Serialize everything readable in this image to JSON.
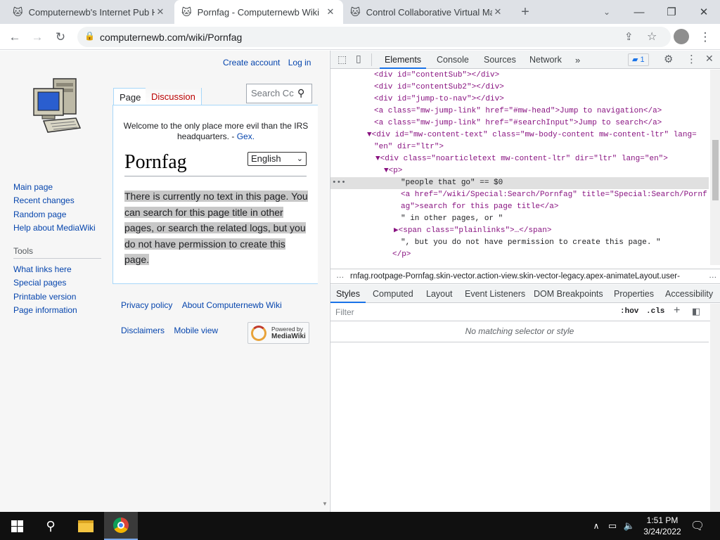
{
  "browser": {
    "tabs": [
      {
        "title": "Computernewb's Internet Pub Hu",
        "active": false
      },
      {
        "title": "Pornfag - Computernewb Wiki",
        "active": true
      },
      {
        "title": "Control Collaborative Virtual Ma",
        "active": false
      }
    ],
    "url": "computernewb.com/wiki/Pornfag"
  },
  "wiki": {
    "personal": {
      "create_account": "Create account",
      "log_in": "Log in"
    },
    "tabs": {
      "page": "Page",
      "discussion": "Discussion"
    },
    "search_placeholder": "Search Cc",
    "welcome_text": "Welcome to the only place more evil than the IRS headquarters. - ",
    "welcome_link": "Gex.",
    "language": "English",
    "title": "Pornfag",
    "body_text": "There is currently no text in this page. You can search for this page title in other pages, or search the related logs, but you do not have permission to create this page.",
    "nav": [
      "Main page",
      "Recent changes",
      "Random page",
      "Help about MediaWiki"
    ],
    "tools_heading": "Tools",
    "tools": [
      "What links here",
      "Special pages",
      "Printable version",
      "Page information"
    ],
    "footer": [
      "Privacy policy",
      "About Computernewb Wiki",
      "Disclaimers",
      "Mobile view"
    ],
    "powered_by_line1": "Powered by",
    "powered_by_line2": "MediaWiki"
  },
  "devtools": {
    "tabs": [
      "Elements",
      "Console",
      "Sources",
      "Network"
    ],
    "issues_count": "1",
    "dom_lines": [
      "<div id=\"contentSub\"></div>",
      "<div id=\"contentSub2\"></div>",
      "<div id=\"jump-to-nav\"></div>",
      "<a class=\"mw-jump-link\" href=\"#mw-head\">Jump to navigation</a>",
      "<a class=\"mw-jump-link\" href=\"#searchInput\">Jump to search</a>",
      "▼<div id=\"mw-content-text\" class=\"mw-body-content mw-content-ltr\" lang=",
      "\"en\" dir=\"ltr\">",
      "▼<div class=\"noarticletext mw-content-ltr\" dir=\"ltr\" lang=\"en\">",
      "▼<p>",
      "\"people that go\" == $0",
      "<a href=\"/wiki/Special:Search/Pornfag\" title=\"Special:Search/Pornf",
      "ag\">search for this page title</a>",
      "\" in other pages, or \"",
      "▶<span class=\"plainlinks\">…</span>",
      "\", but you do not have permission to create this page. \"",
      "</p>"
    ],
    "breadcrumb": "rnfag.rootpage-Pornfag.skin-vector.action-view.skin-vector-legacy.apex-animateLayout.user-",
    "styles_tabs": [
      "Styles",
      "Computed",
      "Layout",
      "Event Listeners",
      "DOM Breakpoints",
      "Properties",
      "Accessibility"
    ],
    "filter_placeholder": "Filter",
    "hov": ":hov",
    "cls": ".cls",
    "no_match": "No matching selector or style"
  },
  "taskbar": {
    "time": "1:51 PM",
    "date": "3/24/2022"
  },
  "colors": {
    "link": "#0645ad",
    "redlink": "#ba0000",
    "tag": "#881280",
    "attr": "#994500",
    "value": "#1a1aa6"
  }
}
